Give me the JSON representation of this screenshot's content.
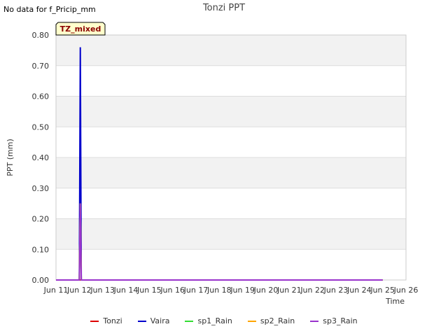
{
  "header": {
    "no_data_text": "No data for f_Pricip_mm",
    "title": "Tonzi PPT",
    "badge": "TZ_mixed"
  },
  "chart_data": {
    "type": "line",
    "title": "Tonzi PPT",
    "xlabel": "Time",
    "ylabel": "PPT (mm)",
    "xlim": [
      "2024-06-11",
      "2024-06-26"
    ],
    "ylim": [
      0,
      0.8
    ],
    "x_ticks": [
      "Jun 11",
      "Jun 12",
      "Jun 13",
      "Jun 14",
      "Jun 15",
      "Jun 16",
      "Jun 17",
      "Jun 18",
      "Jun 19",
      "Jun 20",
      "Jun 21",
      "Jun 22",
      "Jun 23",
      "Jun 24",
      "Jun 25",
      "Jun 26"
    ],
    "y_ticks": [
      "0.00",
      "0.10",
      "0.20",
      "0.30",
      "0.40",
      "0.50",
      "0.60",
      "0.70",
      "0.80"
    ],
    "grid": true,
    "legend_position": "bottom",
    "series": [
      {
        "name": "Tonzi",
        "color": "#dd0000",
        "points": [
          [
            "2024-06-11 00:00",
            0
          ],
          [
            "2024-06-12 00:00",
            0
          ],
          [
            "2024-06-12 01:00",
            0
          ],
          [
            "2024-06-25 00:00",
            0
          ]
        ]
      },
      {
        "name": "Vaira",
        "color": "#0000cc",
        "points": [
          [
            "2024-06-11 00:00",
            0
          ],
          [
            "2024-06-12 00:00",
            0
          ],
          [
            "2024-06-12 01:00",
            0.76
          ],
          [
            "2024-06-12 02:00",
            0
          ],
          [
            "2024-06-25 00:00",
            0
          ]
        ]
      },
      {
        "name": "sp1_Rain",
        "color": "#33dd33",
        "points": [
          [
            "2024-06-11 00:00",
            0
          ],
          [
            "2024-06-12 00:00",
            0
          ],
          [
            "2024-06-12 01:00",
            0.25
          ],
          [
            "2024-06-12 02:00",
            0
          ],
          [
            "2024-06-25 00:00",
            0
          ]
        ]
      },
      {
        "name": "sp2_Rain",
        "color": "#ffa500",
        "points": [
          [
            "2024-06-11 00:00",
            0
          ],
          [
            "2024-06-12 00:00",
            0
          ],
          [
            "2024-06-12 01:00",
            0.25
          ],
          [
            "2024-06-12 02:00",
            0
          ],
          [
            "2024-06-25 00:00",
            0
          ]
        ]
      },
      {
        "name": "sp3_Rain",
        "color": "#9933cc",
        "points": [
          [
            "2024-06-11 00:00",
            0
          ],
          [
            "2024-06-12 00:00",
            0
          ],
          [
            "2024-06-12 01:00",
            0.25
          ],
          [
            "2024-06-12 02:00",
            0
          ],
          [
            "2024-06-25 00:00",
            0
          ]
        ]
      }
    ]
  }
}
